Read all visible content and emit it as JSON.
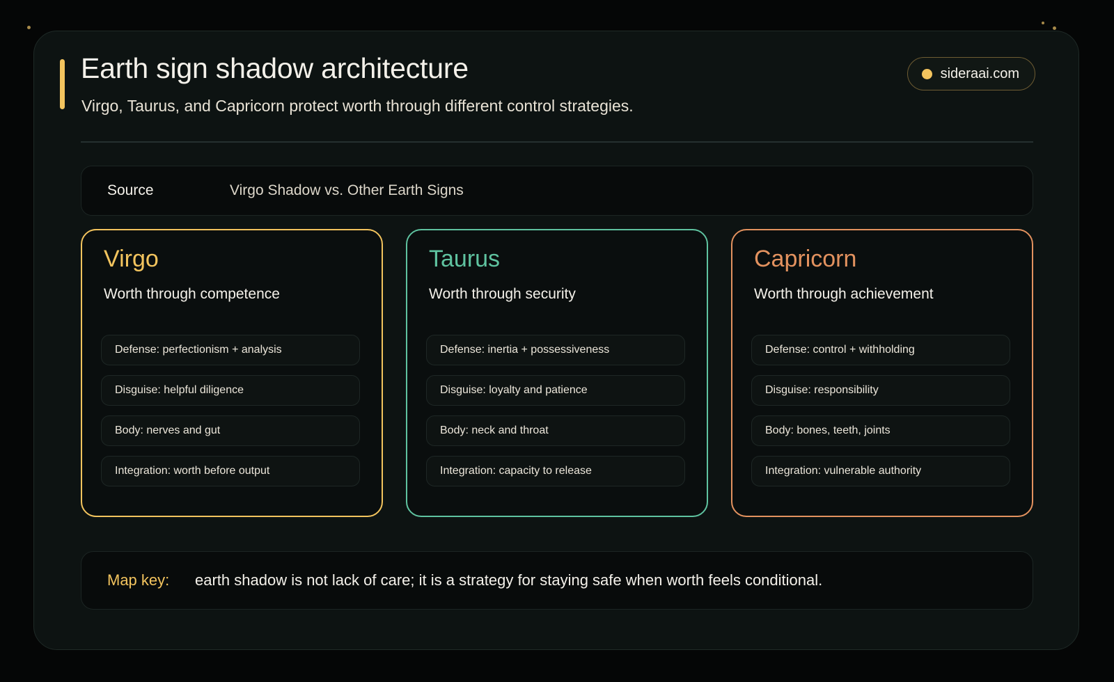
{
  "header": {
    "title": "Earth sign shadow architecture",
    "subtitle": "Virgo, Taurus, and Capricorn protect worth through different control strategies.",
    "brand": "sideraai.com"
  },
  "source": {
    "label": "Source",
    "value": "Virgo Shadow vs. Other Earth Signs"
  },
  "signs": [
    {
      "name": "Virgo",
      "theme": "Worth through competence",
      "color": "#f3c45e",
      "traits": [
        "Defense: perfectionism + analysis",
        "Disguise: helpful diligence",
        "Body: nerves and gut",
        "Integration: worth before output"
      ]
    },
    {
      "name": "Taurus",
      "theme": "Worth through security",
      "color": "#5fc3a0",
      "traits": [
        "Defense: inertia + possessiveness",
        "Disguise: loyalty and patience",
        "Body: neck and throat",
        "Integration: capacity to release"
      ]
    },
    {
      "name": "Capricorn",
      "theme": "Worth through achievement",
      "color": "#e3925f",
      "traits": [
        "Defense: control + withholding",
        "Disguise: responsibility",
        "Body: bones, teeth, joints",
        "Integration: vulnerable authority"
      ]
    }
  ],
  "map_key": {
    "label": "Map key:",
    "text": "earth shadow is not lack of care; it is a strategy for staying safe when worth feels conditional."
  },
  "colors": {
    "accent": "#f3c45e",
    "background": "#050606",
    "card": "#0d1312"
  }
}
